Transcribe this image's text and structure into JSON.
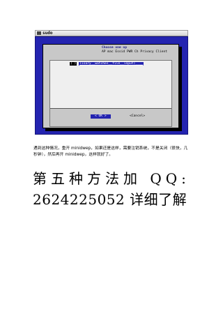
{
  "window": {
    "title": "sudo"
  },
  "menu": {
    "header": "Choose one op",
    "items": "AP mac  Essid  PWR Ch  Privacy  Client"
  },
  "selection": {
    "marker": "(  )",
    "option": "lisary__watches__file__input)____"
  },
  "buttons": {
    "ok": "<  OK  >",
    "cancel": "<Cancel>"
  },
  "note": "遇到这种情况，重开 minidwep，如果还是这样，需要注销系统，不是关闭（很快，几秒钟），然后再开 minidwep，这样就好了。",
  "heading": {
    "line1": "第五种方法加 QQ:",
    "line2": "2624225052 详细了解"
  }
}
